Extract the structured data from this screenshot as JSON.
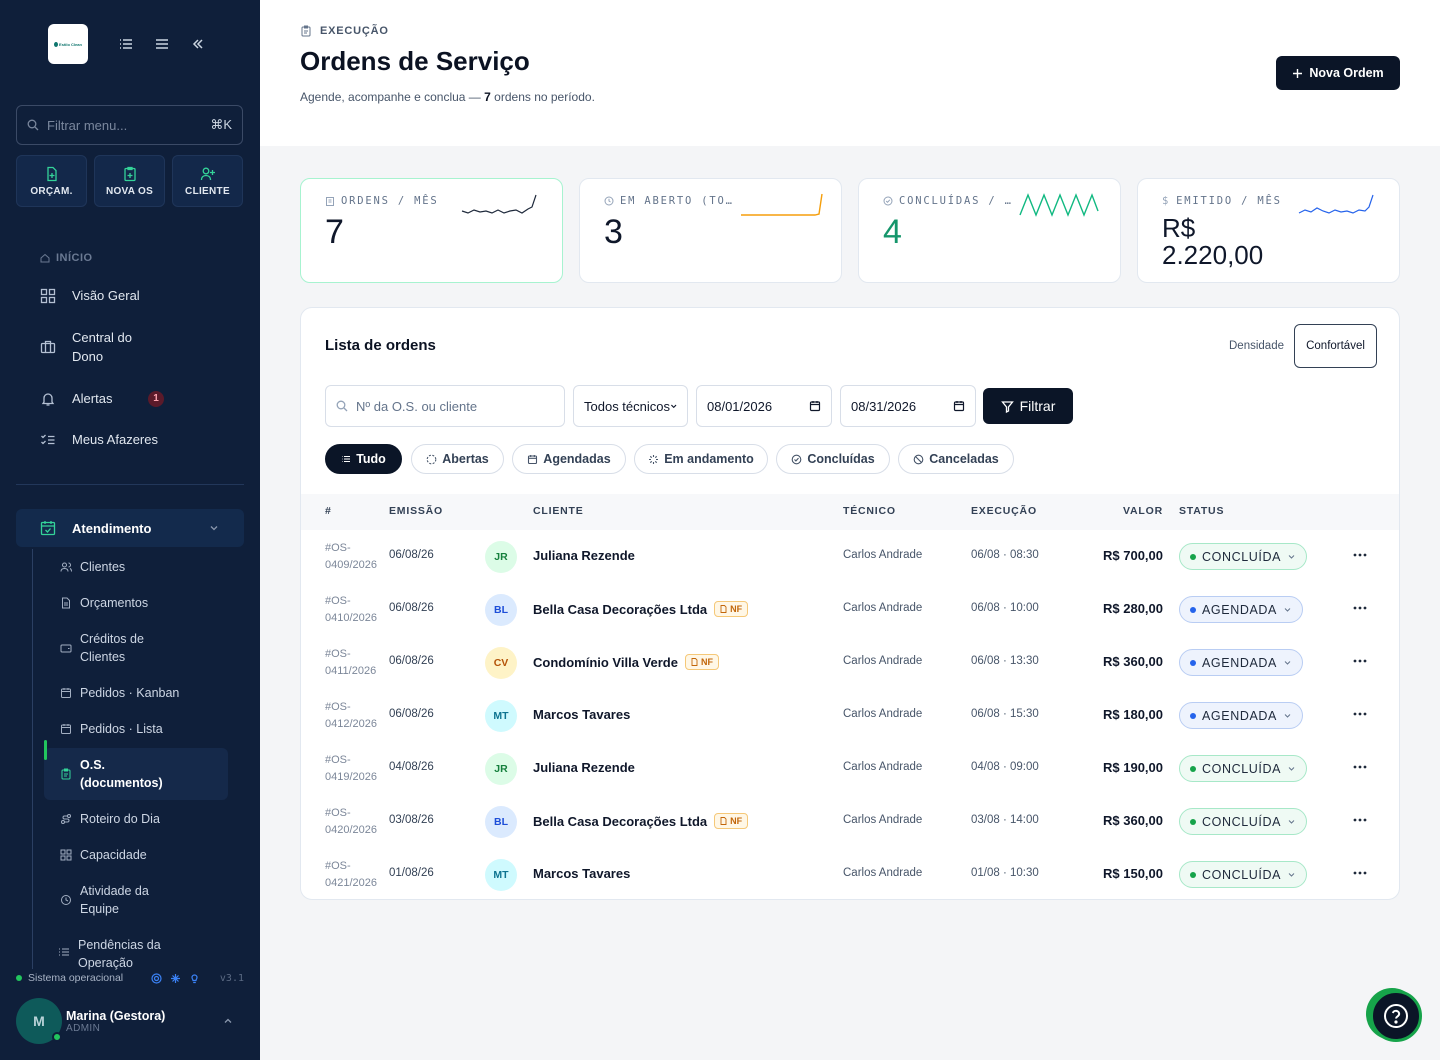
{
  "sidebar": {
    "logo_text": "Estilo Clean",
    "search_placeholder": "Filtrar menu...",
    "search_shortcut": "⌘K",
    "quick_actions": [
      {
        "label": "ORÇAM.",
        "icon": "file-plus-icon"
      },
      {
        "label": "NOVA OS",
        "icon": "clipboard-plus-icon"
      },
      {
        "label": "CLIENTE",
        "icon": "user-plus-icon"
      }
    ],
    "section_inicio": "INÍCIO",
    "nav": [
      {
        "label": "Visão Geral",
        "icon": "grid-icon"
      },
      {
        "label": "Central do Dono",
        "icon": "briefcase-icon"
      },
      {
        "label": "Alertas",
        "icon": "bell-icon",
        "badge": "1"
      },
      {
        "label": "Meus Afazeres",
        "icon": "checklist-icon"
      }
    ],
    "group": {
      "label": "Atendimento",
      "icon": "calendar-check-icon"
    },
    "sub_items": [
      {
        "label": "Clientes",
        "icon": "users-icon"
      },
      {
        "label": "Orçamentos",
        "icon": "file-icon"
      },
      {
        "label": "Créditos de Clientes",
        "icon": "wallet-icon"
      },
      {
        "label": "Pedidos · Kanban",
        "icon": "calendar-icon"
      },
      {
        "label": "Pedidos · Lista",
        "icon": "calendar-icon"
      },
      {
        "label": "O.S. (documentos)",
        "icon": "clipboard-icon",
        "active": true
      },
      {
        "label": "Roteiro do Dia",
        "icon": "route-icon"
      },
      {
        "label": "Capacidade",
        "icon": "grid-icon"
      },
      {
        "label": "Atividade da Equipe",
        "icon": "activity-icon"
      },
      {
        "label": "Pendências da Operação",
        "icon": "list-icon"
      }
    ],
    "status_text": "Sistema operacional",
    "version": "v3.1",
    "user": {
      "name": "Marina (Gestora)",
      "role": "ADMIN",
      "initial": "M"
    }
  },
  "header": {
    "breadcrumb": "EXECUÇÃO",
    "title": "Ordens de Serviço",
    "subtitle_pre": "Agende, acompanhe e conclua —",
    "subtitle_count": "7",
    "subtitle_post": "ordens no período.",
    "new_button": "Nova Ordem"
  },
  "kpis": [
    {
      "label": "ORDENS / MÊS",
      "value": "7",
      "icon": "clipboard-icon",
      "spark_color": "#1e293b"
    },
    {
      "label": "EM ABERTO (TO…",
      "value": "3",
      "icon": "clock-icon",
      "spark_color": "#f59e0b"
    },
    {
      "label": "CONCLUÍDAS / …",
      "value": "4",
      "icon": "check-circle-icon",
      "spark_color": "#10b981"
    },
    {
      "label": "EMITIDO / MÊS",
      "value_line1": "R$",
      "value_line2": "2.220,00",
      "icon": "dollar-icon",
      "spark_color": "#2563eb"
    }
  ],
  "list": {
    "title": "Lista de ordens",
    "density_label": "Densidade",
    "density_value": "Confortável",
    "search_placeholder": "Nº da O.S. ou cliente",
    "tech_select": "Todos técnicos",
    "date_from": "08/01/2026",
    "date_to": "08/31/2026",
    "filter_button": "Filtrar",
    "tabs": [
      {
        "label": "Tudo",
        "icon": "list-icon",
        "active": true
      },
      {
        "label": "Abertas",
        "icon": "circle-dashed-icon"
      },
      {
        "label": "Agendadas",
        "icon": "calendar-icon"
      },
      {
        "label": "Em andamento",
        "icon": "loader-icon"
      },
      {
        "label": "Concluídas",
        "icon": "check-circle-icon"
      },
      {
        "label": "Canceladas",
        "icon": "ban-icon"
      }
    ],
    "columns": [
      "#",
      "EMISSÃO",
      "CLIENTE",
      "TÉCNICO",
      "EXECUÇÃO",
      "VALOR",
      "STATUS"
    ],
    "rows": [
      {
        "os1": "#OS-",
        "os2": "0409/2026",
        "emissao": "06/08/26",
        "initials": "JR",
        "cliente": "Juliana Rezende",
        "nf": false,
        "tecnico": "Carlos Andrade",
        "execucao": "06/08 · 08:30",
        "valor": "R$ 700,00",
        "status": "CONCLUÍDA",
        "kind": "done"
      },
      {
        "os1": "#OS-",
        "os2": "0410/2026",
        "emissao": "06/08/26",
        "initials": "BL",
        "cliente": "Bella Casa Decorações Ltda",
        "nf": true,
        "tecnico": "Carlos Andrade",
        "execucao": "06/08 · 10:00",
        "valor": "R$ 280,00",
        "status": "AGENDADA",
        "kind": "sched"
      },
      {
        "os1": "#OS-",
        "os2": "0411/2026",
        "emissao": "06/08/26",
        "initials": "CV",
        "cliente": "Condomínio Villa Verde",
        "nf": true,
        "tecnico": "Carlos Andrade",
        "execucao": "06/08 · 13:30",
        "valor": "R$ 360,00",
        "status": "AGENDADA",
        "kind": "sched"
      },
      {
        "os1": "#OS-",
        "os2": "0412/2026",
        "emissao": "06/08/26",
        "initials": "MT",
        "cliente": "Marcos Tavares",
        "nf": false,
        "tecnico": "Carlos Andrade",
        "execucao": "06/08 · 15:30",
        "valor": "R$ 180,00",
        "status": "AGENDADA",
        "kind": "sched"
      },
      {
        "os1": "#OS-",
        "os2": "0419/2026",
        "emissao": "04/08/26",
        "initials": "JR",
        "cliente": "Juliana Rezende",
        "nf": false,
        "tecnico": "Carlos Andrade",
        "execucao": "04/08 · 09:00",
        "valor": "R$ 190,00",
        "status": "CONCLUÍDA",
        "kind": "done"
      },
      {
        "os1": "#OS-",
        "os2": "0420/2026",
        "emissao": "03/08/26",
        "initials": "BL",
        "cliente": "Bella Casa Decorações Ltda",
        "nf": true,
        "tecnico": "Carlos Andrade",
        "execucao": "03/08 · 14:00",
        "valor": "R$ 360,00",
        "status": "CONCLUÍDA",
        "kind": "done"
      },
      {
        "os1": "#OS-",
        "os2": "0421/2026",
        "emissao": "01/08/26",
        "initials": "MT",
        "cliente": "Marcos Tavares",
        "nf": false,
        "tecnico": "Carlos Andrade",
        "execucao": "01/08 · 10:30",
        "valor": "R$ 150,00",
        "status": "CONCLUÍDA",
        "kind": "done"
      }
    ],
    "nf_label": "NF"
  },
  "colors": {
    "sidebar_bg": "#0f1f3a",
    "primary": "#0b1527",
    "success": "#16a34a",
    "scheduled": "#2563eb"
  }
}
